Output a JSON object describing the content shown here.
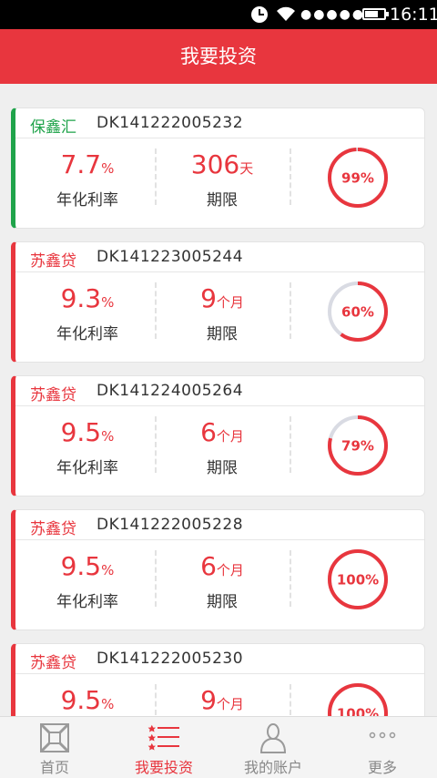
{
  "status_bar": {
    "time": "16:11",
    "signal": "●●●●●"
  },
  "header": {
    "title": "我要投资"
  },
  "labels": {
    "rate": "年化利率",
    "term": "期限"
  },
  "products": [
    {
      "type": "保鑫汇",
      "id": "DK141222005232",
      "rate": "7.7",
      "rate_unit": "%",
      "term": "306",
      "term_unit": "天",
      "progress": 99,
      "progress_text": "99%",
      "accent": "#1fa34a"
    },
    {
      "type": "苏鑫贷",
      "id": "DK141223005244",
      "rate": "9.3",
      "rate_unit": "%",
      "term": "9",
      "term_unit": "个月",
      "progress": 60,
      "progress_text": "60%",
      "accent": "#e8363e"
    },
    {
      "type": "苏鑫贷",
      "id": "DK141224005264",
      "rate": "9.5",
      "rate_unit": "%",
      "term": "6",
      "term_unit": "个月",
      "progress": 79,
      "progress_text": "79%",
      "accent": "#e8363e"
    },
    {
      "type": "苏鑫贷",
      "id": "DK141222005228",
      "rate": "9.5",
      "rate_unit": "%",
      "term": "6",
      "term_unit": "个月",
      "progress": 100,
      "progress_text": "100%",
      "accent": "#e8363e"
    },
    {
      "type": "苏鑫贷",
      "id": "DK141222005230",
      "rate": "9.5",
      "rate_unit": "%",
      "term": "9",
      "term_unit": "个月",
      "progress": 100,
      "progress_text": "100%",
      "accent": "#e8363e"
    }
  ],
  "tabs": [
    {
      "label": "首页",
      "icon": "home-icon"
    },
    {
      "label": "我要投资",
      "icon": "invest-list-icon",
      "active": true
    },
    {
      "label": "我的账户",
      "icon": "account-person-icon"
    },
    {
      "label": "更多",
      "icon": "more-dots-icon"
    }
  ],
  "colors": {
    "brand_red": "#e8363e",
    "green": "#1fa34a",
    "ring_track": "#d9dbe3"
  }
}
